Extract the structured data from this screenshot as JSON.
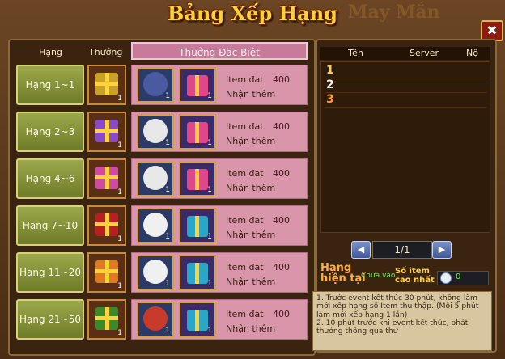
{
  "title": "Bảng Xếp Hạng",
  "background_deco": "May Mắn",
  "close_glyph": "✖",
  "headers": {
    "rank": "Hạng",
    "reward": "Thưởng",
    "special": "Thưởng Đặc Biệt"
  },
  "item_label": "Item đạt",
  "extra_label": "Nhận thêm",
  "item_value": "400",
  "tiers": [
    {
      "rank": "Hạng 1~1",
      "reward_color": "#c8a02a",
      "qty": "1",
      "item_qty": "1",
      "gift_qty": "1",
      "gift": "pink"
    },
    {
      "rank": "Hạng 2~3",
      "reward_color": "#8a4ac8",
      "qty": "1",
      "item_qty": "1",
      "gift_qty": "1",
      "gift": "pink"
    },
    {
      "rank": "Hạng 4~6",
      "reward_color": "#d04aa0",
      "qty": "1",
      "item_qty": "1",
      "gift_qty": "1",
      "gift": "pink"
    },
    {
      "rank": "Hạng 7~10",
      "reward_color": "#b82020",
      "qty": "1",
      "item_qty": "1",
      "gift_qty": "1",
      "gift": "cyan"
    },
    {
      "rank": "Hạng 11~20",
      "reward_color": "#e07a20",
      "qty": "1",
      "item_qty": "1",
      "gift_qty": "1",
      "gift": "cyan"
    },
    {
      "rank": "Hạng 21~50",
      "reward_color": "#3a8a2a",
      "qty": "1",
      "item_qty": "1",
      "gift_qty": "1",
      "gift": "cyan"
    }
  ],
  "leaderboard": {
    "col_name": "Tên",
    "col_server": "Server",
    "col_extra": "Nộ",
    "rows": [
      "1",
      "2",
      "3"
    ],
    "rank_colors": [
      "#ffd23a",
      "#f4f4f4",
      "#ff9a2a"
    ]
  },
  "pager": {
    "prev": "◀",
    "next": "▶",
    "page": "1/1"
  },
  "current_rank_label_line1": "Hạng",
  "current_rank_label_line2": "hiện tại",
  "current_rank_value": "Chưa vào",
  "best_label_line1": "Số item",
  "best_label_line2": "cao nhất",
  "best_value": "0",
  "notes": [
    "1. Trước event kết thúc 30 phút, không làm mới xếp hạng số Item thu thập. (Mỗi 5 phút làm mới xếp hạng 1 lần)",
    "2. 10 phút trước khi event kết thúc, phát thưởng thông qua thư"
  ]
}
